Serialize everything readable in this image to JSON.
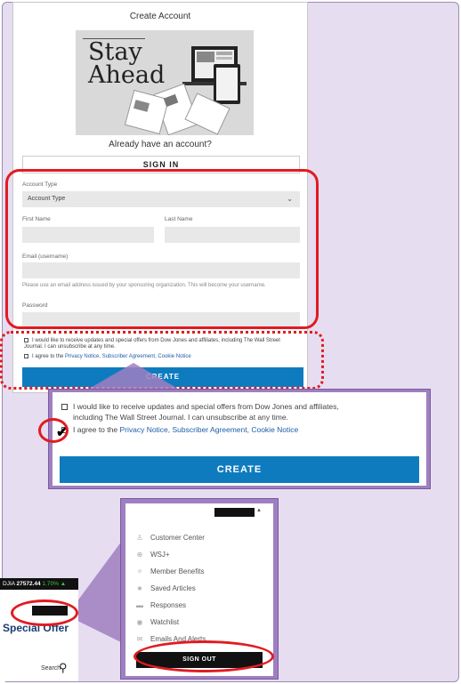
{
  "form": {
    "title": "Create Account",
    "hero_text": "Stay\nAhead",
    "already_text": "Already have an account?",
    "signin_label": "SIGN IN",
    "account_type_label": "Account Type",
    "account_type_value": "Account Type",
    "first_name_label": "First Name",
    "last_name_label": "Last Name",
    "email_label": "Email (username)",
    "email_help": "Please use an email address issued by your sponsoring organization. This will become your username.",
    "password_label": "Password",
    "offers_text": "I would like to receive updates and special offers from Dow Jones and affiliates, including The Wall Street Journal. I can unsubscribe at any time.",
    "agree_prefix": "I agree to the",
    "agree_links": "Privacy Notice, Subscriber Agreement, Cookie Notice",
    "create_label": "CREATE"
  },
  "zoom_consent": {
    "offers_line1": "I would like to receive updates and special offers from Dow Jones and affiliates,",
    "offers_line2": "including The Wall Street Journal. I can unsubscribe at any time.",
    "agree_prefix": "I agree to the",
    "agree_links": "Privacy Notice, Subscriber Agreement, Cookie Notice",
    "create_label": "CREATE"
  },
  "account_menu": {
    "items": [
      {
        "label": "Customer Center",
        "icon": "person-icon"
      },
      {
        "label": "WSJ+",
        "icon": "plus-icon"
      },
      {
        "label": "Member Benefits",
        "icon": "star-icon"
      },
      {
        "label": "Saved Articles",
        "icon": "bookmark-icon"
      },
      {
        "label": "Responses",
        "icon": "chat-icon"
      },
      {
        "label": "Watchlist",
        "icon": "eye-icon"
      },
      {
        "label": "Emails And Alerts",
        "icon": "mail-icon"
      }
    ],
    "signout_label": "SIGN OUT"
  },
  "header_snippet": {
    "djia_label": "DJIA",
    "djia_value": "27572.44",
    "djia_change": "1.70%",
    "special_offer": "Special Offer",
    "search_label": "Search"
  },
  "colors": {
    "highlight": "#e11b22",
    "primary_button": "#0f7bbf",
    "callout_border": "#9f7fc0"
  }
}
